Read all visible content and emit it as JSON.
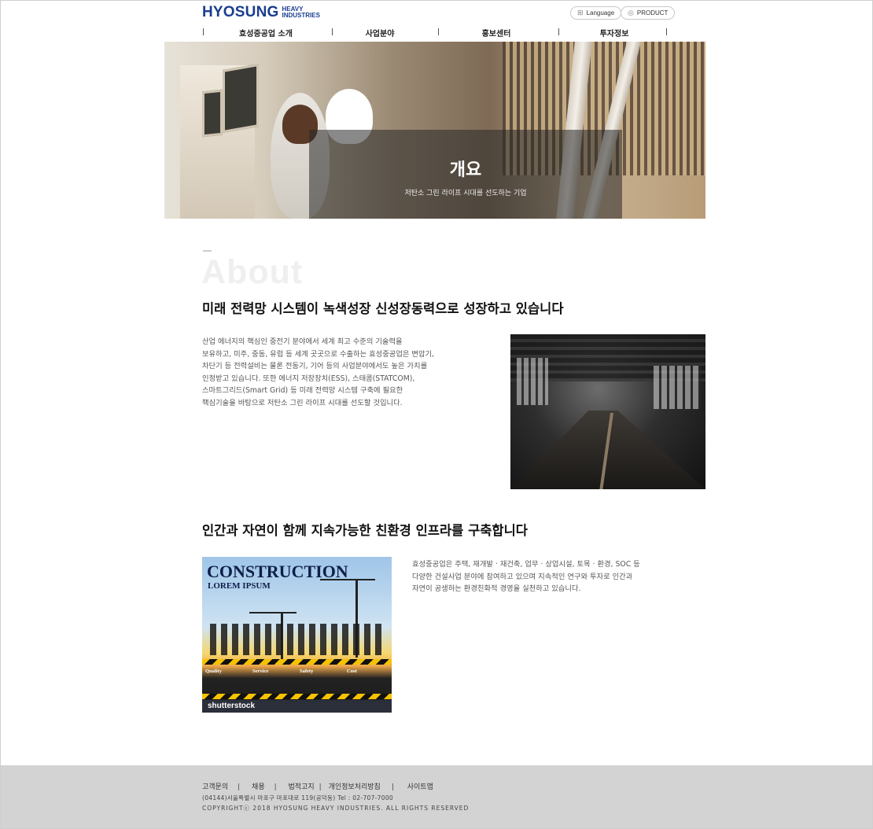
{
  "header": {
    "logo_word": "HYOSUNG",
    "logo_sub_1": "HEAVY",
    "logo_sub_2": "INDUSTRIES",
    "language_label": "Language",
    "product_label": "PRODUCT"
  },
  "nav": {
    "items": [
      {
        "label": "효성중공업 소개"
      },
      {
        "label": "사업분야"
      },
      {
        "label": "홍보센터"
      },
      {
        "label": "투자정보"
      }
    ]
  },
  "hero": {
    "title": "개요",
    "subtitle": "저탄소 그린 라이프 시대를 선도하는 기업"
  },
  "about": {
    "watermark": "About",
    "heading1": "미래 전력망 시스템이 녹색성장 신성장동력으로 성장하고 있습니다",
    "para1_lines": [
      "산업 에너지의 핵심인 중전기 분야에서 세계 최고 수준의 기술력을",
      "보유하고, 미주, 중동, 유럽 등 세계 곳곳으로 수출하는 효성중공업은 변압기,",
      "차단기 등 전력설비는 물론 전동기, 기어 등의 사업분야에서도 높은 가치를",
      "인정받고 있습니다. 또한 에너지 저장장치(ESS), 스태콤(STATCOM),",
      "스마트그리드(Smart Grid) 등 미래 전력망 시스템 구축에 필요한",
      "핵심기술을 바탕으로 저탄소 그린 라이프 시대를 선도할 것입니다."
    ],
    "heading2": "인간과 자연이 함께 지속가능한 친환경 인프라를 구축합니다",
    "para2_lines": [
      "효성중공업은 주택, 재개발 · 재건축, 업무 · 상업시설, 토목 · 환경, SOC 등",
      "다양한 건설사업 분야에 참여하고 있으며 지속적인 연구와 투자로 인간과",
      "자연이 공생하는 환경친화적 경영을 실천하고 있습니다."
    ],
    "image2": {
      "title": "CONSTRUCTION",
      "subtitle": "LOREM IPSUM",
      "boxes": [
        "Quality",
        "Service",
        "Safety",
        "Cost"
      ],
      "brand": "shutterstock"
    }
  },
  "footer": {
    "links": [
      {
        "label": "고객문의"
      },
      {
        "label": "채용"
      },
      {
        "label": "법적고지"
      },
      {
        "label": "개인정보처리방침"
      },
      {
        "label": "사이트맵"
      }
    ],
    "address": "(04144)서울특별시 마포구 마포대로 119(공덕동) Tel : 02-707-7000",
    "copyright": "COPYRIGHTⓒ  2018  HYOSUNG  HEAVY  INDUSTRIES.  ALL  RIGHTS  RESERVED"
  }
}
